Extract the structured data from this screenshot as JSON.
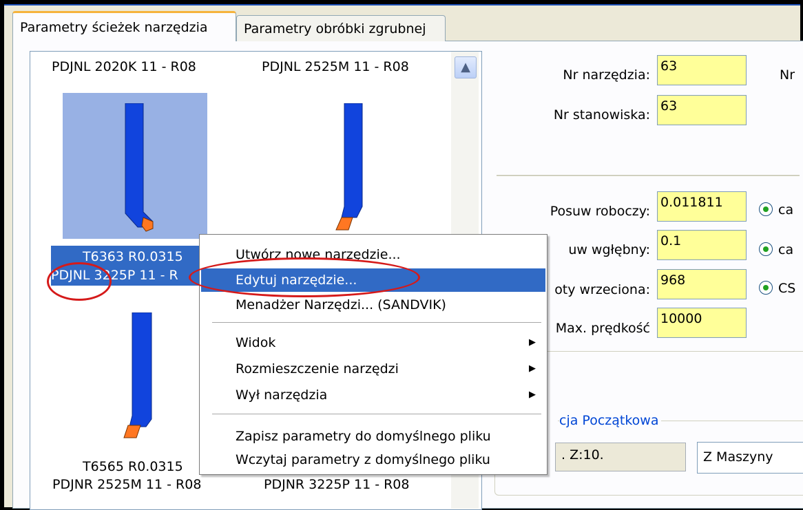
{
  "tabs": [
    {
      "label": "Parametry ścieżek narzędzia",
      "active": true
    },
    {
      "label": "Parametry obróbki zgrubnej",
      "active": false
    }
  ],
  "tools": [
    {
      "line1": "",
      "line2": "PDJNL 2020K 11 - R08"
    },
    {
      "line1": "",
      "line2": "PDJNL 2525M 11 - R08"
    },
    {
      "line1": "T6363 R0.0315",
      "line2": "PDJNL 3225P 11 - R",
      "selected": true
    },
    {
      "line1": "T6565 R0.0315",
      "line2": "PDJNR 2525M 11 - R08"
    },
    {
      "line1": "",
      "line2": "PDJNR 3225P 11 - R08"
    }
  ],
  "form": {
    "tool_no_label": "Nr narzędzia:",
    "tool_no": "63",
    "tool_no2_label": "Nr",
    "station_label": "Nr stanowiska:",
    "station": "63",
    "feed_label": "Posuw roboczy:",
    "feed": "0.011811",
    "feed_unit": "ca",
    "plunge_label": "uw wgłębny:",
    "plunge": "0.1",
    "plunge_unit": "ca",
    "spindle_label": "oty wrzeciona:",
    "spindle": "968",
    "spindle_unit": "CS",
    "maxspeed_label": "Max. prędkość",
    "maxspeed": "10000",
    "group_label": "cja Początkowa",
    "start_pos": ". Z:10.",
    "start_combo": "Z Maszyny"
  },
  "menu": {
    "items": [
      {
        "label": "Utwórz nowe narzędzie...",
        "highlight": false,
        "submenu": false
      },
      {
        "label": "Edytuj narzędzie...",
        "highlight": true,
        "submenu": false
      },
      {
        "label": "Menadżer Narzędzi... (SANDVIK)",
        "highlight": false,
        "submenu": false
      },
      {
        "label": "Widok",
        "highlight": false,
        "submenu": true
      },
      {
        "label": "Rozmieszczenie narzędzi",
        "highlight": false,
        "submenu": true
      },
      {
        "label": "Wył narzędzia",
        "highlight": false,
        "submenu": true
      },
      {
        "label": "Zapisz parametry do domyślnego pliku",
        "highlight": false,
        "submenu": false
      },
      {
        "label": "Wczytaj parametry z domyślnego pliku",
        "highlight": false,
        "submenu": false
      }
    ]
  },
  "icons": {
    "submenu_arrow": "▶",
    "scroll_up": "▲"
  },
  "colors": {
    "selection": "#316ac5",
    "required_field": "#ffff99",
    "tool_body": "#1144dd",
    "tool_insert": "#ff7722",
    "annotation": "#d51a1a"
  }
}
